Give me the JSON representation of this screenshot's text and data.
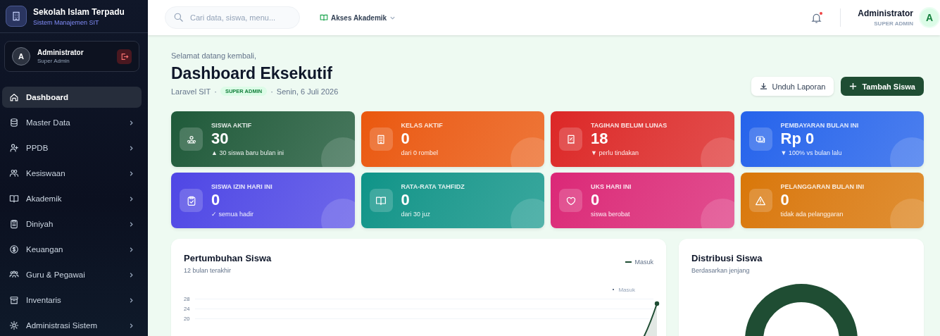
{
  "sidebar": {
    "brand": {
      "title": "Sekolah Islam Terpadu",
      "subtitle": "Sistem Manajemen SIT"
    },
    "user": {
      "initial": "A",
      "name": "Administrator",
      "role": "Super Admin"
    },
    "menu": [
      {
        "label": "Dashboard",
        "selected": true,
        "has_submenu": false
      },
      {
        "label": "Master Data",
        "selected": false,
        "has_submenu": true
      },
      {
        "label": "PPDB",
        "selected": false,
        "has_submenu": true
      },
      {
        "label": "Kesiswaan",
        "selected": false,
        "has_submenu": true
      },
      {
        "label": "Akademik",
        "selected": false,
        "has_submenu": true
      },
      {
        "label": "Diniyah",
        "selected": false,
        "has_submenu": true
      },
      {
        "label": "Keuangan",
        "selected": false,
        "has_submenu": true
      },
      {
        "label": "Guru & Pegawai",
        "selected": false,
        "has_submenu": true
      },
      {
        "label": "Inventaris",
        "selected": false,
        "has_submenu": true
      },
      {
        "label": "Administrasi Sistem",
        "selected": false,
        "has_submenu": true
      }
    ]
  },
  "topbar": {
    "search": {
      "placeholder": "Cari data, siswa, menu..."
    },
    "access": {
      "label": "Akses Akademik"
    },
    "notification": {
      "unread": true
    },
    "user": {
      "name": "Administrator",
      "role": "SUPER ADMIN",
      "initial": "A"
    }
  },
  "header": {
    "greeting": "Selamat datang kembali,",
    "title": "Dashboard Eksekutif",
    "app": "Laravel SIT",
    "role_badge": "SUPER ADMIN",
    "date": "Senin, 6 Juli 2026",
    "separator": "·",
    "buttons": [
      {
        "label": "Unduh Laporan",
        "kind": "secondary"
      },
      {
        "label": "Tambah Siswa",
        "kind": "primary"
      }
    ]
  },
  "stats": [
    {
      "label": "SISWA AKTIF",
      "value": "30",
      "note": "▲ 30 siswa baru bulan ini",
      "color": "#1f5a3a"
    },
    {
      "label": "KELAS AKTIF",
      "value": "0",
      "note": "dari 0 rombel",
      "color": "#ea580c"
    },
    {
      "label": "TAGIHAN BELUM LUNAS",
      "value": "18",
      "note": "▼ perlu tindakan",
      "color": "#dc2626"
    },
    {
      "label": "PEMBAYARAN BULAN INI",
      "value": "Rp 0",
      "note": "▼ 100% vs bulan lalu",
      "color": "#2563eb"
    },
    {
      "label": "SISWA IZIN HARI INI",
      "value": "0",
      "note": "✓ semua hadir",
      "color": "#4f46e5"
    },
    {
      "label": "RATA-RATA TAHFIDZ",
      "value": "0",
      "note": "dari 30 juz",
      "color": "#0d9488"
    },
    {
      "label": "UKS HARI INI",
      "value": "0",
      "note": "siswa berobat",
      "color": "#db2777"
    },
    {
      "label": "PELANGGARAN BULAN INI",
      "value": "0",
      "note": "tidak ada pelanggaran",
      "color": "#d97706"
    }
  ],
  "growth": {
    "title": "Pertumbuhan Siswa",
    "subtitle": "12 bulan terakhir",
    "legend": "Masuk",
    "point_label": "Masuk",
    "y_labels": [
      "28",
      "24",
      "20"
    ]
  },
  "distribution": {
    "title": "Distribusi Siswa",
    "subtitle": "Berdasarkan jenjang"
  }
}
